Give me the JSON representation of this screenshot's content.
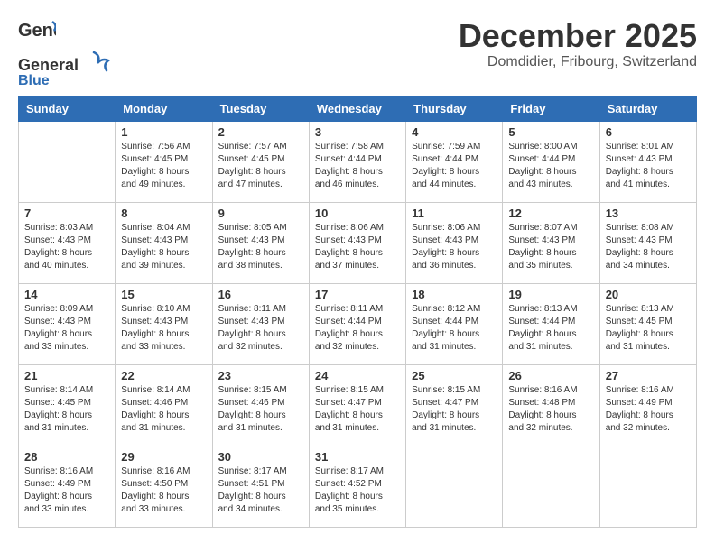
{
  "header": {
    "logo_general": "General",
    "logo_blue": "Blue",
    "month_title": "December 2025",
    "subtitle": "Domdidier, Fribourg, Switzerland"
  },
  "days_of_week": [
    "Sunday",
    "Monday",
    "Tuesday",
    "Wednesday",
    "Thursday",
    "Friday",
    "Saturday"
  ],
  "weeks": [
    [
      {
        "day": "",
        "info": ""
      },
      {
        "day": "1",
        "info": "Sunrise: 7:56 AM\nSunset: 4:45 PM\nDaylight: 8 hours\nand 49 minutes."
      },
      {
        "day": "2",
        "info": "Sunrise: 7:57 AM\nSunset: 4:45 PM\nDaylight: 8 hours\nand 47 minutes."
      },
      {
        "day": "3",
        "info": "Sunrise: 7:58 AM\nSunset: 4:44 PM\nDaylight: 8 hours\nand 46 minutes."
      },
      {
        "day": "4",
        "info": "Sunrise: 7:59 AM\nSunset: 4:44 PM\nDaylight: 8 hours\nand 44 minutes."
      },
      {
        "day": "5",
        "info": "Sunrise: 8:00 AM\nSunset: 4:44 PM\nDaylight: 8 hours\nand 43 minutes."
      },
      {
        "day": "6",
        "info": "Sunrise: 8:01 AM\nSunset: 4:43 PM\nDaylight: 8 hours\nand 41 minutes."
      }
    ],
    [
      {
        "day": "7",
        "info": "Sunrise: 8:03 AM\nSunset: 4:43 PM\nDaylight: 8 hours\nand 40 minutes."
      },
      {
        "day": "8",
        "info": "Sunrise: 8:04 AM\nSunset: 4:43 PM\nDaylight: 8 hours\nand 39 minutes."
      },
      {
        "day": "9",
        "info": "Sunrise: 8:05 AM\nSunset: 4:43 PM\nDaylight: 8 hours\nand 38 minutes."
      },
      {
        "day": "10",
        "info": "Sunrise: 8:06 AM\nSunset: 4:43 PM\nDaylight: 8 hours\nand 37 minutes."
      },
      {
        "day": "11",
        "info": "Sunrise: 8:06 AM\nSunset: 4:43 PM\nDaylight: 8 hours\nand 36 minutes."
      },
      {
        "day": "12",
        "info": "Sunrise: 8:07 AM\nSunset: 4:43 PM\nDaylight: 8 hours\nand 35 minutes."
      },
      {
        "day": "13",
        "info": "Sunrise: 8:08 AM\nSunset: 4:43 PM\nDaylight: 8 hours\nand 34 minutes."
      }
    ],
    [
      {
        "day": "14",
        "info": "Sunrise: 8:09 AM\nSunset: 4:43 PM\nDaylight: 8 hours\nand 33 minutes."
      },
      {
        "day": "15",
        "info": "Sunrise: 8:10 AM\nSunset: 4:43 PM\nDaylight: 8 hours\nand 33 minutes."
      },
      {
        "day": "16",
        "info": "Sunrise: 8:11 AM\nSunset: 4:43 PM\nDaylight: 8 hours\nand 32 minutes."
      },
      {
        "day": "17",
        "info": "Sunrise: 8:11 AM\nSunset: 4:44 PM\nDaylight: 8 hours\nand 32 minutes."
      },
      {
        "day": "18",
        "info": "Sunrise: 8:12 AM\nSunset: 4:44 PM\nDaylight: 8 hours\nand 31 minutes."
      },
      {
        "day": "19",
        "info": "Sunrise: 8:13 AM\nSunset: 4:44 PM\nDaylight: 8 hours\nand 31 minutes."
      },
      {
        "day": "20",
        "info": "Sunrise: 8:13 AM\nSunset: 4:45 PM\nDaylight: 8 hours\nand 31 minutes."
      }
    ],
    [
      {
        "day": "21",
        "info": "Sunrise: 8:14 AM\nSunset: 4:45 PM\nDaylight: 8 hours\nand 31 minutes."
      },
      {
        "day": "22",
        "info": "Sunrise: 8:14 AM\nSunset: 4:46 PM\nDaylight: 8 hours\nand 31 minutes."
      },
      {
        "day": "23",
        "info": "Sunrise: 8:15 AM\nSunset: 4:46 PM\nDaylight: 8 hours\nand 31 minutes."
      },
      {
        "day": "24",
        "info": "Sunrise: 8:15 AM\nSunset: 4:47 PM\nDaylight: 8 hours\nand 31 minutes."
      },
      {
        "day": "25",
        "info": "Sunrise: 8:15 AM\nSunset: 4:47 PM\nDaylight: 8 hours\nand 31 minutes."
      },
      {
        "day": "26",
        "info": "Sunrise: 8:16 AM\nSunset: 4:48 PM\nDaylight: 8 hours\nand 32 minutes."
      },
      {
        "day": "27",
        "info": "Sunrise: 8:16 AM\nSunset: 4:49 PM\nDaylight: 8 hours\nand 32 minutes."
      }
    ],
    [
      {
        "day": "28",
        "info": "Sunrise: 8:16 AM\nSunset: 4:49 PM\nDaylight: 8 hours\nand 33 minutes."
      },
      {
        "day": "29",
        "info": "Sunrise: 8:16 AM\nSunset: 4:50 PM\nDaylight: 8 hours\nand 33 minutes."
      },
      {
        "day": "30",
        "info": "Sunrise: 8:17 AM\nSunset: 4:51 PM\nDaylight: 8 hours\nand 34 minutes."
      },
      {
        "day": "31",
        "info": "Sunrise: 8:17 AM\nSunset: 4:52 PM\nDaylight: 8 hours\nand 35 minutes."
      },
      {
        "day": "",
        "info": ""
      },
      {
        "day": "",
        "info": ""
      },
      {
        "day": "",
        "info": ""
      }
    ]
  ]
}
